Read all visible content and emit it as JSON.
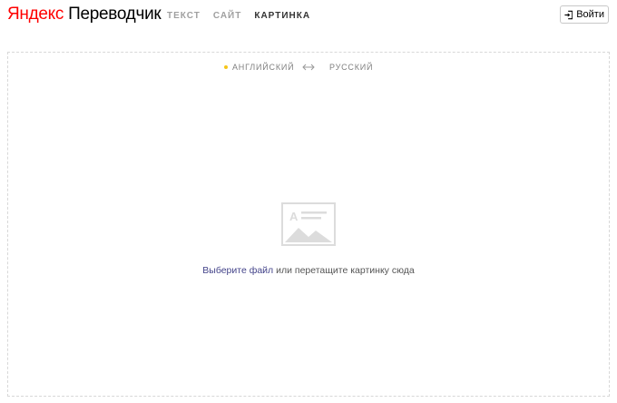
{
  "header": {
    "logo_brand": "Яндекс",
    "logo_product": "Переводчик",
    "tabs": [
      {
        "label": "ТЕКСТ",
        "active": false
      },
      {
        "label": "САЙТ",
        "active": false
      },
      {
        "label": "КАРТИНКА",
        "active": true
      }
    ],
    "login_label": "Войти",
    "login_icon": "login-icon"
  },
  "languages": {
    "source": "АНГЛИЙСКИЙ",
    "target": "РУССКИЙ",
    "swap_icon": "swap-arrow-icon"
  },
  "dropzone": {
    "icon": "image-placeholder-icon",
    "link_text": "Выберите файл",
    "rest_text": " или перетащите картинку сюда"
  },
  "colors": {
    "brand_red": "#ff0000",
    "source_dot": "#f5c518",
    "link": "#44448a"
  }
}
